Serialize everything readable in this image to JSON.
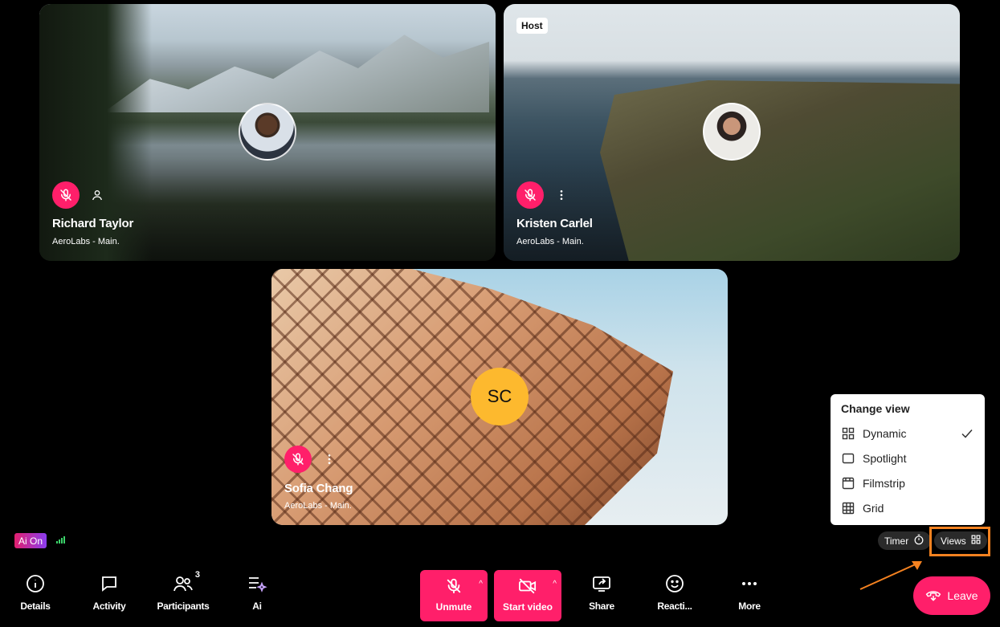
{
  "participants": [
    {
      "name": "Richard Taylor",
      "org": "AeroLabs - Main.",
      "muted": true
    },
    {
      "name": "Kristen Carlel",
      "org": "AeroLabs - Main.",
      "muted": true,
      "badge": "Host"
    },
    {
      "name": "Sofia Chang",
      "org": "AeroLabs - Main.",
      "muted": true,
      "initials": "SC"
    }
  ],
  "status": {
    "ai_label": "Ai On"
  },
  "controls": {
    "timer": "Timer",
    "views": "Views"
  },
  "view_menu": {
    "title": "Change view",
    "items": [
      {
        "label": "Dynamic",
        "icon": "grid-2x2-icon",
        "selected": true
      },
      {
        "label": "Spotlight",
        "icon": "rectangle-icon",
        "selected": false
      },
      {
        "label": "Filmstrip",
        "icon": "filmstrip-icon",
        "selected": false
      },
      {
        "label": "Grid",
        "icon": "grid-3x3-icon",
        "selected": false
      }
    ]
  },
  "toolbar": {
    "details": "Details",
    "activity": "Activity",
    "participants": "Participants",
    "participants_count": "3",
    "ai": "Ai",
    "unmute": "Unmute",
    "start_video": "Start video",
    "share": "Share",
    "reactions": "Reacti...",
    "more": "More",
    "leave": "Leave"
  },
  "colors": {
    "accent": "#ff1f6a",
    "highlight": "#f58220",
    "initials_bg": "#fdb92e"
  }
}
